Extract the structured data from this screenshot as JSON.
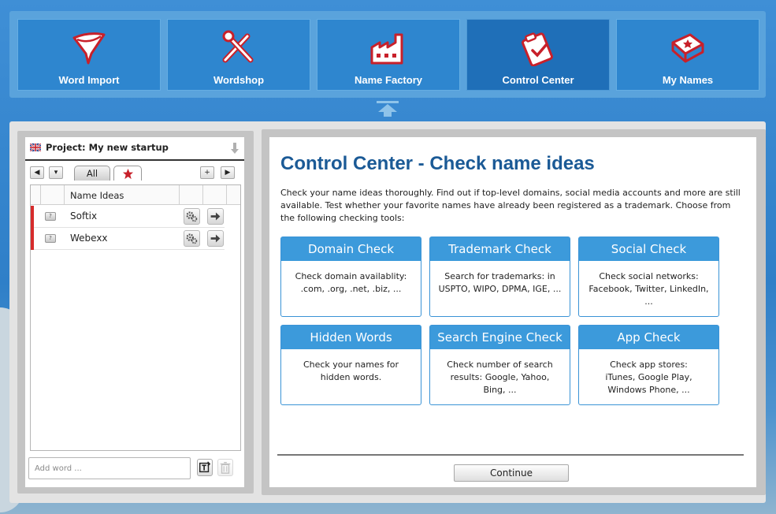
{
  "nav": {
    "tiles": [
      {
        "label": "Word Import",
        "icon": "funnel-icon"
      },
      {
        "label": "Wordshop",
        "icon": "tools-icon"
      },
      {
        "label": "Name Factory",
        "icon": "factory-icon"
      },
      {
        "label": "Control Center",
        "icon": "clipboard-check-icon",
        "active": true
      },
      {
        "label": "My Names",
        "icon": "book-star-icon"
      }
    ]
  },
  "project": {
    "title": "Project: My new startup",
    "tabs": {
      "all": "All"
    },
    "nav_buttons": {
      "prev": "◀",
      "down": "▾",
      "add": "+",
      "next": "▶"
    },
    "list": {
      "column_header": "Name Ideas",
      "rows": [
        {
          "name": "Softix"
        },
        {
          "name": "Webexx"
        }
      ]
    },
    "add_word_placeholder": "Add word ..."
  },
  "control_center": {
    "title": "Control Center - Check name ideas",
    "intro": "Check your name ideas thoroughly. Find out if top-level domains, social media accounts and more are still available. Test whether your favorite names have already been registered as a trademark. Choose from the following checking tools:",
    "cards": [
      {
        "title": "Domain Check",
        "body": "Check domain availablity: .com, .org, .net, .biz, ..."
      },
      {
        "title": "Trademark Check",
        "body": "Search for trademarks: in USPTO, WIPO, DPMA, IGE, ..."
      },
      {
        "title": "Social Check",
        "body": "Check social networks: Facebook, Twitter, LinkedIn, ..."
      },
      {
        "title": "Hidden Words",
        "body": "Check your names for hidden words."
      },
      {
        "title": "Search Engine Check",
        "body": "Check number of search results: Google, Yahoo, Bing, ..."
      },
      {
        "title": "App Check",
        "body": "Check app stores: iTunes, Google Play, Windows Phone, ..."
      }
    ],
    "continue_label": "Continue"
  },
  "colors": {
    "accent": "#3c9adb",
    "title": "#1b5a96",
    "nav_tile": "#2e86cf",
    "nav_tile_active": "#1f6fb8",
    "row_marker": "#d62b2b"
  }
}
